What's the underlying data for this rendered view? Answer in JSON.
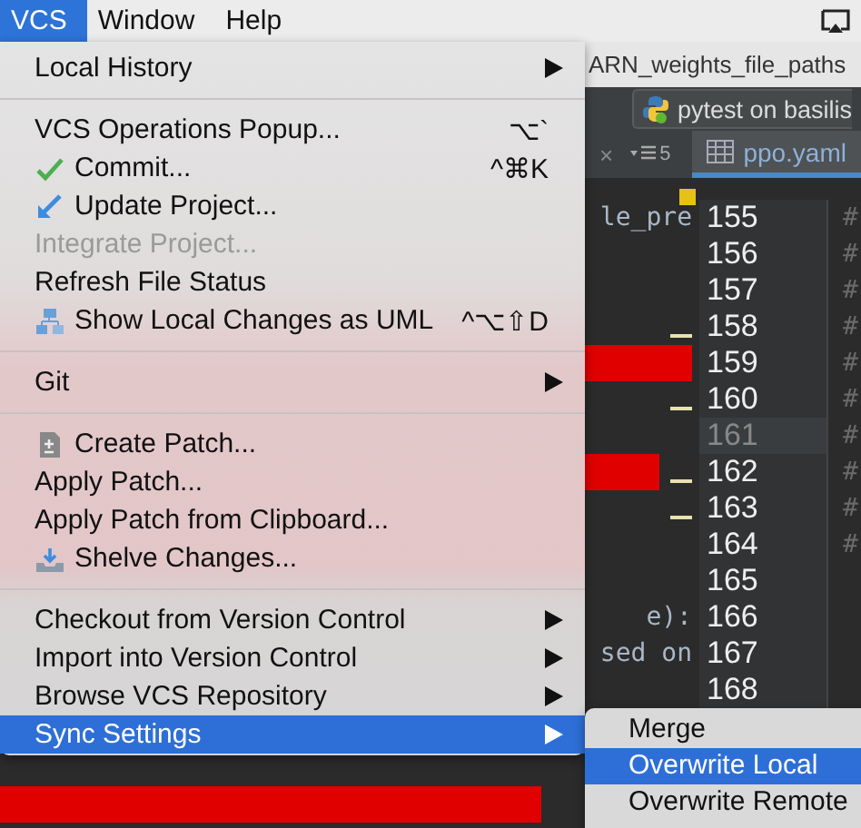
{
  "menubar": [
    {
      "label": "VCS",
      "selected": true
    },
    {
      "label": "Window",
      "selected": false
    },
    {
      "label": "Help",
      "selected": false
    }
  ],
  "editor": {
    "window_title": "ARN_weights_file_paths",
    "run_config": "pytest on basilis",
    "tab_close": "×",
    "tab_count": "5",
    "file_tab": "ppo.yaml",
    "lines": [
      {
        "number": "155",
        "code": "le_pre",
        "right": "#",
        "current": false,
        "change_mark": false,
        "redacted": false,
        "bookmark": true
      },
      {
        "number": "156",
        "right": "#",
        "current": false,
        "change_mark": false,
        "redacted": false,
        "bookmark": false
      },
      {
        "number": "157",
        "right": "#",
        "current": false,
        "change_mark": false,
        "redacted": false,
        "bookmark": false
      },
      {
        "number": "158",
        "right": "#",
        "current": false,
        "change_mark": true,
        "redacted": false,
        "bookmark": false
      },
      {
        "number": "159",
        "right": "#",
        "current": false,
        "change_mark": false,
        "redacted": true,
        "bookmark": false
      },
      {
        "number": "160",
        "right": "#",
        "current": false,
        "change_mark": true,
        "redacted": false,
        "bookmark": false
      },
      {
        "number": "161",
        "right": "#",
        "current": true,
        "change_mark": false,
        "redacted": false,
        "bookmark": false
      },
      {
        "number": "162",
        "right": "#",
        "current": false,
        "change_mark": true,
        "redacted": true,
        "bookmark": false
      },
      {
        "number": "163",
        "right": "#",
        "current": false,
        "change_mark": true,
        "redacted": false,
        "bookmark": false
      },
      {
        "number": "164",
        "right": "#",
        "current": false,
        "change_mark": false,
        "redacted": false,
        "bookmark": false
      },
      {
        "number": "165",
        "current": false,
        "change_mark": false,
        "redacted": false,
        "bookmark": false
      },
      {
        "number": "166",
        "code": "e):",
        "current": false,
        "change_mark": false,
        "redacted": false,
        "bookmark": false
      },
      {
        "number": "167",
        "code": "sed on",
        "current": false,
        "change_mark": false,
        "redacted": false,
        "bookmark": false
      },
      {
        "number": "168",
        "current": false,
        "change_mark": false,
        "redacted": false,
        "bookmark": false
      }
    ]
  },
  "menu": {
    "items": [
      {
        "kind": "item",
        "label": "Local History",
        "submenu": true,
        "disabled": false,
        "selected": false
      },
      {
        "kind": "separator"
      },
      {
        "kind": "item",
        "label": "VCS Operations Popup...",
        "shortcut": "⌥`",
        "submenu": false,
        "disabled": false,
        "selected": false
      },
      {
        "kind": "item",
        "label": "Commit...",
        "shortcut": "^⌘K",
        "submenu": false,
        "disabled": false,
        "selected": false
      },
      {
        "kind": "item",
        "label": "Update Project...",
        "submenu": false,
        "disabled": false,
        "selected": false
      },
      {
        "kind": "item",
        "label": "Integrate Project...",
        "submenu": false,
        "disabled": true,
        "selected": false
      },
      {
        "kind": "item",
        "label": "Refresh File Status",
        "submenu": false,
        "disabled": false,
        "selected": false
      },
      {
        "kind": "item",
        "label": "Show Local Changes as UML",
        "shortcut": "^⌥⇧D",
        "submenu": false,
        "disabled": false,
        "selected": false
      },
      {
        "kind": "separator"
      },
      {
        "kind": "item",
        "label": "Git",
        "submenu": true,
        "disabled": false,
        "selected": false
      },
      {
        "kind": "separator"
      },
      {
        "kind": "item",
        "label": "Create Patch...",
        "submenu": false,
        "disabled": false,
        "selected": false
      },
      {
        "kind": "item",
        "label": "Apply Patch...",
        "submenu": false,
        "disabled": false,
        "selected": false
      },
      {
        "kind": "item",
        "label": "Apply Patch from Clipboard...",
        "submenu": false,
        "disabled": false,
        "selected": false
      },
      {
        "kind": "item",
        "label": "Shelve Changes...",
        "submenu": false,
        "disabled": false,
        "selected": false
      },
      {
        "kind": "separator"
      },
      {
        "kind": "item",
        "label": "Checkout from Version Control",
        "submenu": true,
        "disabled": false,
        "selected": false
      },
      {
        "kind": "item",
        "label": "Import into Version Control",
        "submenu": true,
        "disabled": false,
        "selected": false
      },
      {
        "kind": "item",
        "label": "Browse VCS Repository",
        "submenu": true,
        "disabled": false,
        "selected": false
      },
      {
        "kind": "item",
        "label": "Sync Settings",
        "submenu": true,
        "disabled": false,
        "selected": true
      }
    ]
  },
  "submenu": {
    "items": [
      {
        "label": "Merge",
        "selected": false
      },
      {
        "label": "Overwrite Local",
        "selected": true
      },
      {
        "label": "Overwrite Remote",
        "selected": false
      }
    ]
  }
}
